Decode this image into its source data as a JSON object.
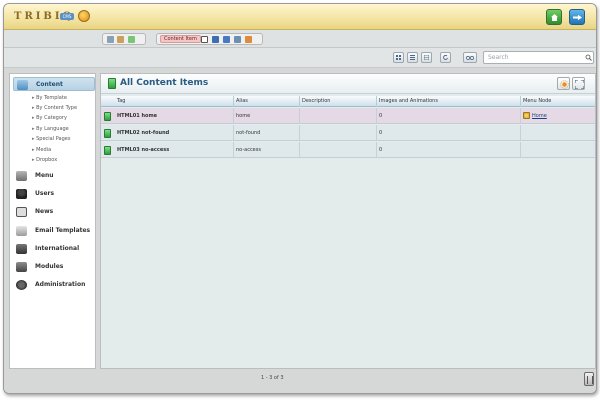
{
  "app": {
    "logo_text": "TRIBIQ",
    "logo_badge": "CMS"
  },
  "toolbar": {
    "content_item_label": "Content Item"
  },
  "search": {
    "placeholder": "Search"
  },
  "sidebar": {
    "content": {
      "label": "Content",
      "sub_items": [
        "By Template",
        "By Content Type",
        "By Category",
        "By Language",
        "Special Pages",
        "Media",
        "Dropbox"
      ]
    },
    "items": [
      {
        "label": "Menu",
        "icon": "menu-icon"
      },
      {
        "label": "Users",
        "icon": "users-icon"
      },
      {
        "label": "News",
        "icon": "news-icon"
      },
      {
        "label": "Email Templates",
        "icon": "email-templates-icon"
      },
      {
        "label": "International",
        "icon": "international-icon"
      },
      {
        "label": "Modules",
        "icon": "modules-icon"
      },
      {
        "label": "Administration",
        "icon": "administration-icon"
      }
    ]
  },
  "main": {
    "title": "All Content Items",
    "columns": [
      "Tag",
      "Alias",
      "Description",
      "Images and Animations",
      "Menu Node"
    ],
    "rows": [
      {
        "tag": "HTML01 home",
        "alias": "home",
        "description": "",
        "images": "0",
        "menu_node": "Home",
        "selected": true
      },
      {
        "tag": "HTML02 not-found",
        "alias": "not-found",
        "description": "",
        "images": "0",
        "menu_node": "",
        "selected": false
      },
      {
        "tag": "HTML03 no-access",
        "alias": "no-access",
        "description": "",
        "images": "0",
        "menu_node": "",
        "selected": false
      }
    ]
  },
  "footer": {
    "pager_text": "1 - 3 of 3"
  },
  "colors": {
    "topbar": "#f3e4a2",
    "accent": "#2a5b83",
    "selected_row": "#e4d9e4"
  }
}
